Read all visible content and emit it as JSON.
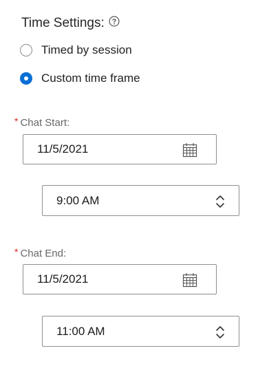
{
  "time_settings": {
    "title": "Time Settings:",
    "help_icon": "question-circle-icon",
    "options": [
      {
        "label": "Timed by session",
        "selected": false
      },
      {
        "label": "Custom time frame",
        "selected": true
      }
    ]
  },
  "chat_start": {
    "required_marker": "*",
    "label": "Chat Start:",
    "date": "11/5/2021",
    "time": "9:00 AM"
  },
  "chat_end": {
    "required_marker": "*",
    "label": "Chat End:",
    "date": "11/5/2021",
    "time": "11:00 AM"
  },
  "colors": {
    "accent": "#0a6fd6",
    "required": "#d0271d"
  }
}
